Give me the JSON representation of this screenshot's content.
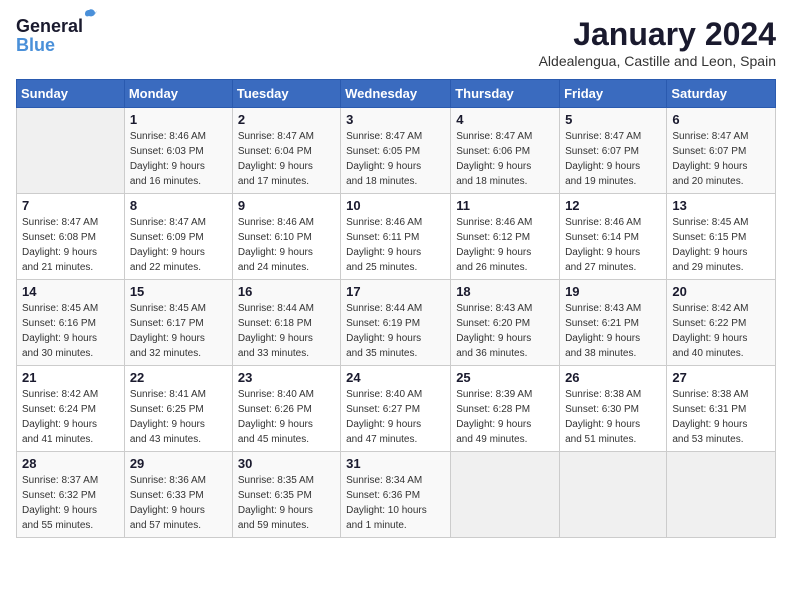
{
  "header": {
    "logo_general": "General",
    "logo_blue": "Blue",
    "month_title": "January 2024",
    "subtitle": "Aldealengua, Castille and Leon, Spain"
  },
  "days_of_week": [
    "Sunday",
    "Monday",
    "Tuesday",
    "Wednesday",
    "Thursday",
    "Friday",
    "Saturday"
  ],
  "weeks": [
    [
      {
        "day": "",
        "info": ""
      },
      {
        "day": "1",
        "info": "Sunrise: 8:46 AM\nSunset: 6:03 PM\nDaylight: 9 hours\nand 16 minutes."
      },
      {
        "day": "2",
        "info": "Sunrise: 8:47 AM\nSunset: 6:04 PM\nDaylight: 9 hours\nand 17 minutes."
      },
      {
        "day": "3",
        "info": "Sunrise: 8:47 AM\nSunset: 6:05 PM\nDaylight: 9 hours\nand 18 minutes."
      },
      {
        "day": "4",
        "info": "Sunrise: 8:47 AM\nSunset: 6:06 PM\nDaylight: 9 hours\nand 18 minutes."
      },
      {
        "day": "5",
        "info": "Sunrise: 8:47 AM\nSunset: 6:07 PM\nDaylight: 9 hours\nand 19 minutes."
      },
      {
        "day": "6",
        "info": "Sunrise: 8:47 AM\nSunset: 6:07 PM\nDaylight: 9 hours\nand 20 minutes."
      }
    ],
    [
      {
        "day": "7",
        "info": "Sunrise: 8:47 AM\nSunset: 6:08 PM\nDaylight: 9 hours\nand 21 minutes."
      },
      {
        "day": "8",
        "info": "Sunrise: 8:47 AM\nSunset: 6:09 PM\nDaylight: 9 hours\nand 22 minutes."
      },
      {
        "day": "9",
        "info": "Sunrise: 8:46 AM\nSunset: 6:10 PM\nDaylight: 9 hours\nand 24 minutes."
      },
      {
        "day": "10",
        "info": "Sunrise: 8:46 AM\nSunset: 6:11 PM\nDaylight: 9 hours\nand 25 minutes."
      },
      {
        "day": "11",
        "info": "Sunrise: 8:46 AM\nSunset: 6:12 PM\nDaylight: 9 hours\nand 26 minutes."
      },
      {
        "day": "12",
        "info": "Sunrise: 8:46 AM\nSunset: 6:14 PM\nDaylight: 9 hours\nand 27 minutes."
      },
      {
        "day": "13",
        "info": "Sunrise: 8:45 AM\nSunset: 6:15 PM\nDaylight: 9 hours\nand 29 minutes."
      }
    ],
    [
      {
        "day": "14",
        "info": "Sunrise: 8:45 AM\nSunset: 6:16 PM\nDaylight: 9 hours\nand 30 minutes."
      },
      {
        "day": "15",
        "info": "Sunrise: 8:45 AM\nSunset: 6:17 PM\nDaylight: 9 hours\nand 32 minutes."
      },
      {
        "day": "16",
        "info": "Sunrise: 8:44 AM\nSunset: 6:18 PM\nDaylight: 9 hours\nand 33 minutes."
      },
      {
        "day": "17",
        "info": "Sunrise: 8:44 AM\nSunset: 6:19 PM\nDaylight: 9 hours\nand 35 minutes."
      },
      {
        "day": "18",
        "info": "Sunrise: 8:43 AM\nSunset: 6:20 PM\nDaylight: 9 hours\nand 36 minutes."
      },
      {
        "day": "19",
        "info": "Sunrise: 8:43 AM\nSunset: 6:21 PM\nDaylight: 9 hours\nand 38 minutes."
      },
      {
        "day": "20",
        "info": "Sunrise: 8:42 AM\nSunset: 6:22 PM\nDaylight: 9 hours\nand 40 minutes."
      }
    ],
    [
      {
        "day": "21",
        "info": "Sunrise: 8:42 AM\nSunset: 6:24 PM\nDaylight: 9 hours\nand 41 minutes."
      },
      {
        "day": "22",
        "info": "Sunrise: 8:41 AM\nSunset: 6:25 PM\nDaylight: 9 hours\nand 43 minutes."
      },
      {
        "day": "23",
        "info": "Sunrise: 8:40 AM\nSunset: 6:26 PM\nDaylight: 9 hours\nand 45 minutes."
      },
      {
        "day": "24",
        "info": "Sunrise: 8:40 AM\nSunset: 6:27 PM\nDaylight: 9 hours\nand 47 minutes."
      },
      {
        "day": "25",
        "info": "Sunrise: 8:39 AM\nSunset: 6:28 PM\nDaylight: 9 hours\nand 49 minutes."
      },
      {
        "day": "26",
        "info": "Sunrise: 8:38 AM\nSunset: 6:30 PM\nDaylight: 9 hours\nand 51 minutes."
      },
      {
        "day": "27",
        "info": "Sunrise: 8:38 AM\nSunset: 6:31 PM\nDaylight: 9 hours\nand 53 minutes."
      }
    ],
    [
      {
        "day": "28",
        "info": "Sunrise: 8:37 AM\nSunset: 6:32 PM\nDaylight: 9 hours\nand 55 minutes."
      },
      {
        "day": "29",
        "info": "Sunrise: 8:36 AM\nSunset: 6:33 PM\nDaylight: 9 hours\nand 57 minutes."
      },
      {
        "day": "30",
        "info": "Sunrise: 8:35 AM\nSunset: 6:35 PM\nDaylight: 9 hours\nand 59 minutes."
      },
      {
        "day": "31",
        "info": "Sunrise: 8:34 AM\nSunset: 6:36 PM\nDaylight: 10 hours\nand 1 minute."
      },
      {
        "day": "",
        "info": ""
      },
      {
        "day": "",
        "info": ""
      },
      {
        "day": "",
        "info": ""
      }
    ]
  ]
}
